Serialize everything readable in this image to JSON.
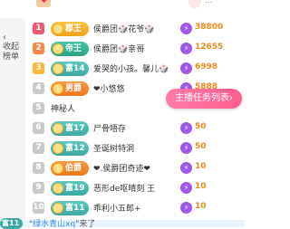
{
  "header": {
    "partial_text": "..."
  },
  "sidebar": {
    "collapse_label": "收起榜单"
  },
  "task_button": {
    "label": "主播任务列表"
  },
  "rows": [
    {
      "rank": "1",
      "badge": "郡王",
      "badge_color": "#eda21a",
      "name": "侯爵团🎲花爷🎲",
      "score": "38800"
    },
    {
      "rank": "2",
      "badge": "帝王",
      "badge_color": "#2aa386",
      "name": "侯爵团🎲亲哥",
      "score": "12655"
    },
    {
      "rank": "3",
      "badge": "富14",
      "badge_color": "#3aa9a1",
      "name": "爱哭的小孩。馨儿🎲",
      "score": "6998"
    },
    {
      "rank": "4",
      "badge": "男爵",
      "badge_color": "#ee7719",
      "name": "❤小悠悠",
      "score": "5888"
    },
    {
      "rank": "5",
      "badge": "",
      "badge_color": "",
      "name": "神秘人",
      "score": ""
    },
    {
      "rank": "6",
      "badge": "富17",
      "badge_color": "#3aa9a1",
      "name": "尸骨唔存",
      "score": "50"
    },
    {
      "rank": "7",
      "badge": "富12",
      "badge_color": "#3aa9a1",
      "name": "圣诞树特洞",
      "score": "50"
    },
    {
      "rank": "8",
      "badge": "伯爵",
      "badge_color": "#ee7719",
      "name": "❤.侯爵团奇迹❤",
      "score": "10"
    },
    {
      "rank": "9",
      "badge": "富19",
      "badge_color": "#3aa9a1",
      "name": "恶形de呕晴刻 王",
      "score": "10"
    },
    {
      "rank": "10",
      "badge": "富11",
      "badge_color": "#3aa9a1",
      "name": "乖利小五郎+",
      "score": "10"
    }
  ],
  "footer": {
    "badge": "富11",
    "prefix": "\"",
    "username": "绿水青山xq",
    "suffix": "\"来了"
  }
}
